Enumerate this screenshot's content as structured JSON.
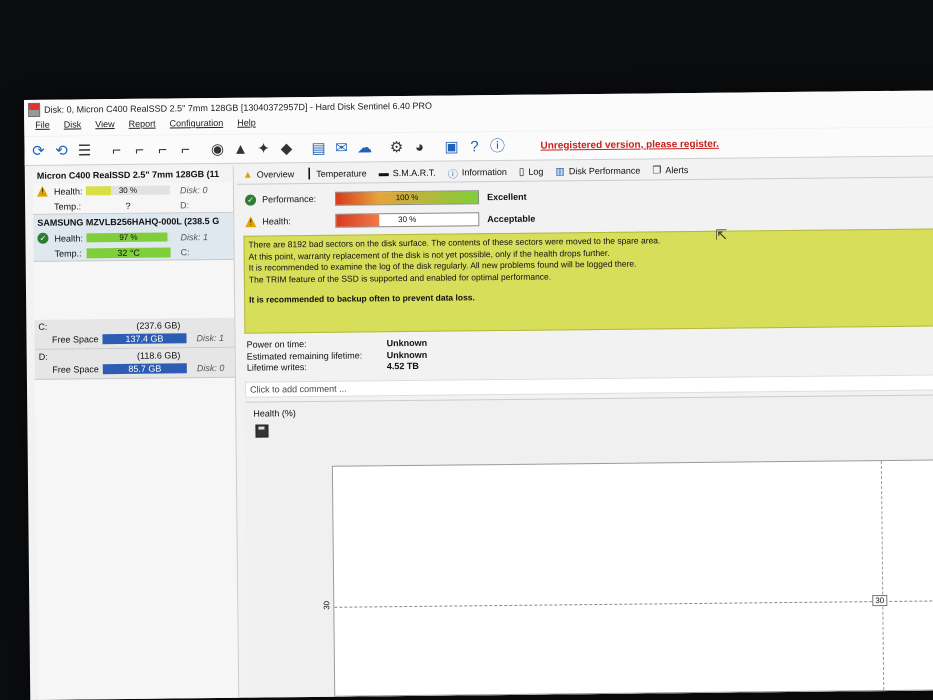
{
  "window": {
    "title": "Disk: 0, Micron C400 RealSSD 2.5\" 7mm 128GB [13040372957D]  -  Hard Disk Sentinel 6.40 PRO"
  },
  "menu": [
    "File",
    "Disk",
    "View",
    "Report",
    "Configuration",
    "Help"
  ],
  "toolbar": {
    "register_text": "Unregistered version, please register."
  },
  "disks": [
    {
      "name": "Micron C400 RealSSD 2.5\" 7mm 128GB (11",
      "status": "warning",
      "health_label": "Health:",
      "health_value": "30 %",
      "health_pct": 30,
      "health_color": "#d8e048",
      "temp_label": "Temp.:",
      "temp_value": "?",
      "disk_num": "Disk: 0",
      "drive": "D:"
    },
    {
      "name": "SAMSUNG MZVLB256HAHQ-000L (238.5 G",
      "status": "ok",
      "health_label": "Health:",
      "health_value": "97 %",
      "health_pct": 97,
      "health_color": "#7fcf3a",
      "temp_label": "Temp.:",
      "temp_value": "32 °C",
      "disk_num": "Disk: 1",
      "drive": "C:"
    }
  ],
  "volumes": [
    {
      "letter": "C:",
      "size": "(237.6 GB)",
      "free_label": "Free Space",
      "free": "137.4 GB",
      "disk": "Disk: 1"
    },
    {
      "letter": "D:",
      "size": "(118.6 GB)",
      "free_label": "Free Space",
      "free": "85.7 GB",
      "disk": "Disk: 0"
    }
  ],
  "tabs": [
    "Overview",
    "Temperature",
    "S.M.A.R.T.",
    "Information",
    "Log",
    "Disk Performance",
    "Alerts"
  ],
  "performance": {
    "label": "Performance:",
    "value": "100 %",
    "pct": 100,
    "rating": "Excellent"
  },
  "health": {
    "label": "Health:",
    "value": "30 %",
    "pct": 30,
    "rating": "Acceptable"
  },
  "message": {
    "lines": [
      "There are 8192 bad sectors on the disk surface. The contents of these sectors were moved to the spare area.",
      "At this point, warranty replacement of the disk is not yet possible, only if the health drops further.",
      "It is recommended to examine the log of the disk regularly. All new problems found will be logged there.",
      "The TRIM feature of the SSD is supported and enabled for optimal performance."
    ],
    "recommendation": "It is recommended to backup often to prevent data loss."
  },
  "info": [
    {
      "key": "Power on time:",
      "value": "Unknown"
    },
    {
      "key": "Estimated remaining lifetime:",
      "value": "Unknown"
    },
    {
      "key": "Lifetime writes:",
      "value": "4.52 TB"
    }
  ],
  "comment_placeholder": "Click to add comment ...",
  "graph": {
    "title": "Health (%)",
    "y_tick": "30",
    "value_label": "30"
  },
  "colors": {
    "accent": "#c8201c",
    "message_bg": "#d6de5a",
    "bar_red": "#d93a1d",
    "bar_green": "#7fcf3a"
  }
}
